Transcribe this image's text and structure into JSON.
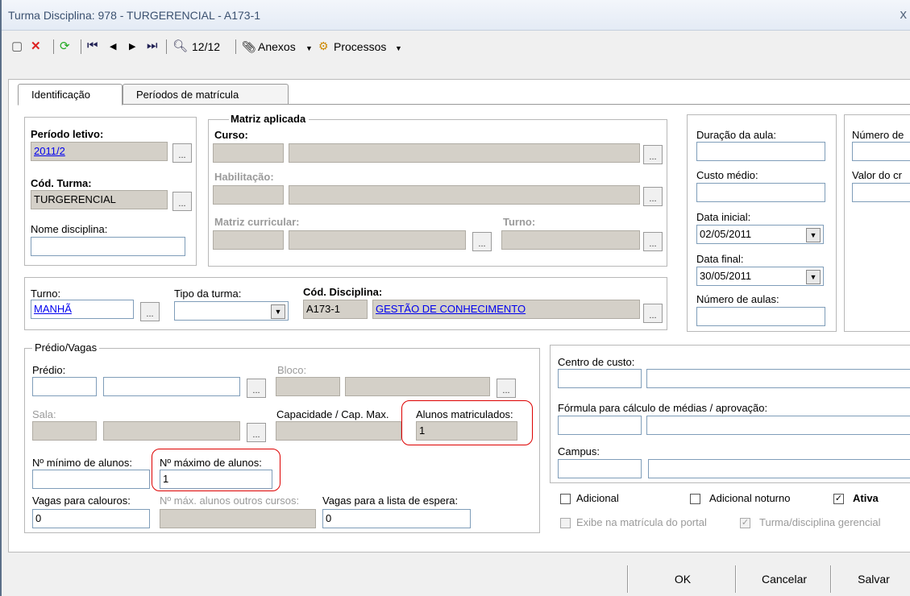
{
  "window": {
    "title": "Turma Disciplina: 978 - TURGERENCIAL - A173-1",
    "close": "x"
  },
  "toolbar": {
    "record_counter": "12/12",
    "anexos_label": "Anexos",
    "processos_label": "Processos"
  },
  "tabs": [
    {
      "label": "Identificação"
    },
    {
      "label": "Períodos de matrícula"
    }
  ],
  "periodo": {
    "periodo_label": "Período letivo:",
    "periodo_value": "2011/2",
    "turma_label": "Cód. Turma:",
    "turma_value": "TURGERENCIAL",
    "nome_label": "Nome disciplina:",
    "nome_value": ""
  },
  "matriz": {
    "title": "Matriz aplicada",
    "curso_label": "Curso:",
    "habilitacao_label": "Habilitação:",
    "matriz_curricular_label": "Matriz curricular:",
    "turno_label": "Turno:"
  },
  "aula": {
    "duracao_label": "Duração da aula:",
    "custo_label": "Custo médio:",
    "data_inicial_label": "Data inicial:",
    "data_inicial_value": "02/05/2011",
    "data_final_label": "Data final:",
    "data_final_value": "30/05/2011",
    "numero_aulas_label": "Número de aulas:",
    "numero_de_label": "Número de",
    "valor_label": "Valor do cr"
  },
  "turno_row": {
    "turno_label": "Turno:",
    "turno_value": "MANHÃ",
    "tipo_label": "Tipo da turma:",
    "tipo_value": "",
    "disciplina_label": "Cód. Disciplina:",
    "disciplina_code": "A173-1",
    "disciplina_name": "GESTÃO DE CONHECIMENTO"
  },
  "predio": {
    "group_title": "Prédio/Vagas",
    "predio_label": "Prédio:",
    "bloco_label": "Bloco:",
    "sala_label": "Sala:",
    "capacidade_label": "Capacidade / Cap. Max.",
    "alunos_label": "Alunos matriculados:",
    "alunos_value": "1",
    "min_label": "Nº mínimo de alunos:",
    "min_value": "",
    "max_label": "Nº máximo de alunos:",
    "max_value": "1",
    "calouros_label": "Vagas para calouros:",
    "calouros_value": "0",
    "outros_label": "Nº máx. alunos outros cursos:",
    "outros_value": "",
    "espera_label": "Vagas para a lista de espera:",
    "espera_value": "0"
  },
  "right": {
    "centro_label": "Centro de custo:",
    "formula_label": "Fórmula para cálculo de médias / aprovação:",
    "campus_label": "Campus:"
  },
  "checks": {
    "adicional": "Adicional",
    "adicional_noturno": "Adicional noturno",
    "ativa": "Ativa",
    "exibe": "Exibe na matrícula do portal",
    "gerencial": "Turma/disciplina gerencial"
  },
  "buttons": {
    "ok": "OK",
    "cancelar": "Cancelar",
    "salvar": "Salvar"
  },
  "colors": {
    "highlight_box": "#dd0000",
    "disabled_field": "#d4d0c8",
    "link": "#0000ee"
  }
}
